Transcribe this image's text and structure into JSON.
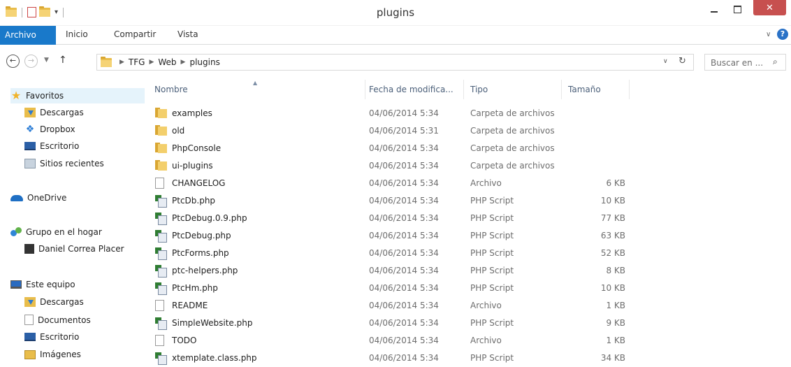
{
  "window": {
    "title": "plugins",
    "close_symbol": "✕"
  },
  "ribbon": {
    "tabs": [
      "Archivo",
      "Inicio",
      "Compartir",
      "Vista"
    ],
    "help_symbol": "?"
  },
  "address": {
    "crumbs": [
      "TFG",
      "Web",
      "plugins"
    ],
    "search_placeholder": "Buscar en ..."
  },
  "nav_pane": {
    "favorites_label": "Favoritos",
    "favorites": [
      "Descargas",
      "Dropbox",
      "Escritorio",
      "Sitios recientes"
    ],
    "onedrive_label": "OneDrive",
    "homegroup_label": "Grupo en el hogar",
    "homegroup_user": "Daniel Correa Placer",
    "this_pc_label": "Este equipo",
    "this_pc": [
      "Descargas",
      "Documentos",
      "Escritorio",
      "Imágenes"
    ]
  },
  "columns": {
    "name": "Nombre",
    "date": "Fecha de modifica...",
    "type": "Tipo",
    "size": "Tamaño"
  },
  "files": [
    {
      "name": "examples",
      "date": "04/06/2014 5:34",
      "type": "Carpeta de archivos",
      "size": "",
      "icon": "folder-icon"
    },
    {
      "name": "old",
      "date": "04/06/2014 5:31",
      "type": "Carpeta de archivos",
      "size": "",
      "icon": "folder-icon"
    },
    {
      "name": "PhpConsole",
      "date": "04/06/2014 5:34",
      "type": "Carpeta de archivos",
      "size": "",
      "icon": "folder-icon"
    },
    {
      "name": "ui-plugins",
      "date": "04/06/2014 5:34",
      "type": "Carpeta de archivos",
      "size": "",
      "icon": "folder-icon"
    },
    {
      "name": "CHANGELOG",
      "date": "04/06/2014 5:34",
      "type": "Archivo",
      "size": "6 KB",
      "icon": "file-icon"
    },
    {
      "name": "PtcDb.php",
      "date": "04/06/2014 5:34",
      "type": "PHP Script",
      "size": "10 KB",
      "icon": "php-file-icon"
    },
    {
      "name": "PtcDebug.0.9.php",
      "date": "04/06/2014 5:34",
      "type": "PHP Script",
      "size": "77 KB",
      "icon": "php-file-icon"
    },
    {
      "name": "PtcDebug.php",
      "date": "04/06/2014 5:34",
      "type": "PHP Script",
      "size": "63 KB",
      "icon": "php-file-icon"
    },
    {
      "name": "PtcForms.php",
      "date": "04/06/2014 5:34",
      "type": "PHP Script",
      "size": "52 KB",
      "icon": "php-file-icon"
    },
    {
      "name": "ptc-helpers.php",
      "date": "04/06/2014 5:34",
      "type": "PHP Script",
      "size": "8 KB",
      "icon": "php-file-icon"
    },
    {
      "name": "PtcHm.php",
      "date": "04/06/2014 5:34",
      "type": "PHP Script",
      "size": "10 KB",
      "icon": "php-file-icon"
    },
    {
      "name": "README",
      "date": "04/06/2014 5:34",
      "type": "Archivo",
      "size": "1 KB",
      "icon": "file-icon"
    },
    {
      "name": "SimpleWebsite.php",
      "date": "04/06/2014 5:34",
      "type": "PHP Script",
      "size": "9 KB",
      "icon": "php-file-icon"
    },
    {
      "name": "TODO",
      "date": "04/06/2014 5:34",
      "type": "Archivo",
      "size": "1 KB",
      "icon": "file-icon"
    },
    {
      "name": "xtemplate.class.php",
      "date": "04/06/2014 5:34",
      "type": "PHP Script",
      "size": "34 KB",
      "icon": "php-file-icon"
    }
  ],
  "colors": {
    "accent": "#1979ca",
    "close": "#c7504f",
    "selection": "#e5f3fb"
  }
}
